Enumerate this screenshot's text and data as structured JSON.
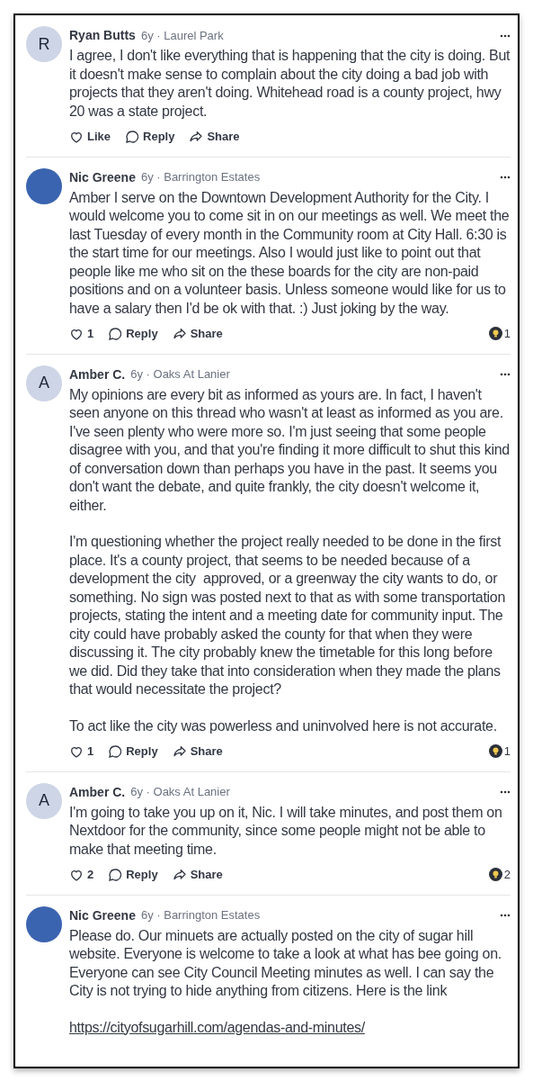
{
  "comments": [
    {
      "author": "Ryan Butts",
      "meta": "6y · Laurel Park",
      "avatar": {
        "kind": "initial",
        "letter": "R"
      },
      "body": [
        {
          "kind": "text",
          "text": "I agree, I don't like everything that is happening that the city is doing. But it doesn't make sense to complain about the city doing a bad job with projects that they aren't doing. Whitehead road is a county project, hwy 20 was a state project."
        }
      ],
      "actions": {
        "like": "Like",
        "reply": "Reply",
        "share": "Share"
      }
    },
    {
      "author": "Nic Greene",
      "meta": "6y · Barrington Estates",
      "avatar": {
        "kind": "photo"
      },
      "body": [
        {
          "kind": "text",
          "text": "Amber I serve on the Downtown Development Authority for the City. I would welcome you to come sit in on our meetings as well. We meet the last Tuesday of every month in the Community room at City Hall. 6:30 is the start time for our meetings. Also I would just like to point out that people like me who sit on the these boards for the city are non-paid positions and on a volunteer basis. Unless someone would like for us to have a salary then I'd be ok with that. :) Just joking by the way."
        }
      ],
      "actions": {
        "like": "1",
        "reply": "Reply",
        "share": "Share"
      },
      "reactions": "1"
    },
    {
      "author": "Amber C.",
      "meta": "6y · Oaks At Lanier",
      "avatar": {
        "kind": "initial",
        "letter": "A"
      },
      "body": [
        {
          "kind": "text",
          "text": "My opinions are every bit as informed as yours are. In fact, I haven't seen anyone on this thread who wasn't at least as informed as you are. I've seen plenty who were more so. I'm just seeing that some people disagree with you, and that you're finding it more difficult to shut this kind of conversation down than perhaps you have in the past. It seems you don't want the debate, and quite frankly, the city doesn't welcome it, either."
        },
        {
          "kind": "text",
          "text": "I'm questioning whether the project really needed to be done in the first place. It's a county project, that seems to be needed because of a development the city  approved, or a greenway the city wants to do, or something. No sign was posted next to that as with some transportation projects, stating the intent and a meeting date for community input. The city could have probably asked the county for that when they were discussing it. The city probably knew the timetable for this long before we did. Did they take that into consideration when they made the plans that would necessitate the project?"
        },
        {
          "kind": "text",
          "text": "To act like the city was powerless and uninvolved here is not accurate."
        }
      ],
      "actions": {
        "like": "1",
        "reply": "Reply",
        "share": "Share"
      },
      "reactions": "1"
    },
    {
      "author": "Amber C.",
      "meta": "6y · Oaks At Lanier",
      "avatar": {
        "kind": "initial",
        "letter": "A"
      },
      "body": [
        {
          "kind": "text",
          "text": "I'm going to take you up on it, Nic. I will take minutes, and post them on Nextdoor for the community, since some people might not be able to make that meeting time."
        }
      ],
      "actions": {
        "like": "2",
        "reply": "Reply",
        "share": "Share"
      },
      "reactions": "2"
    },
    {
      "author": "Nic Greene",
      "meta": "6y · Barrington Estates",
      "avatar": {
        "kind": "photo"
      },
      "body": [
        {
          "kind": "text",
          "text": "Please do. Our minuets are actually posted on the city of sugar hill website. Everyone is welcome to take a look at what has bee going on. Everyone can see City Council Meeting minutes as well. I can say the City is not trying to hide anything from citizens. Here is the link"
        },
        {
          "kind": "link",
          "text": "https://cityofsugarhill.com/agendas-and-minutes/"
        }
      ]
    }
  ]
}
